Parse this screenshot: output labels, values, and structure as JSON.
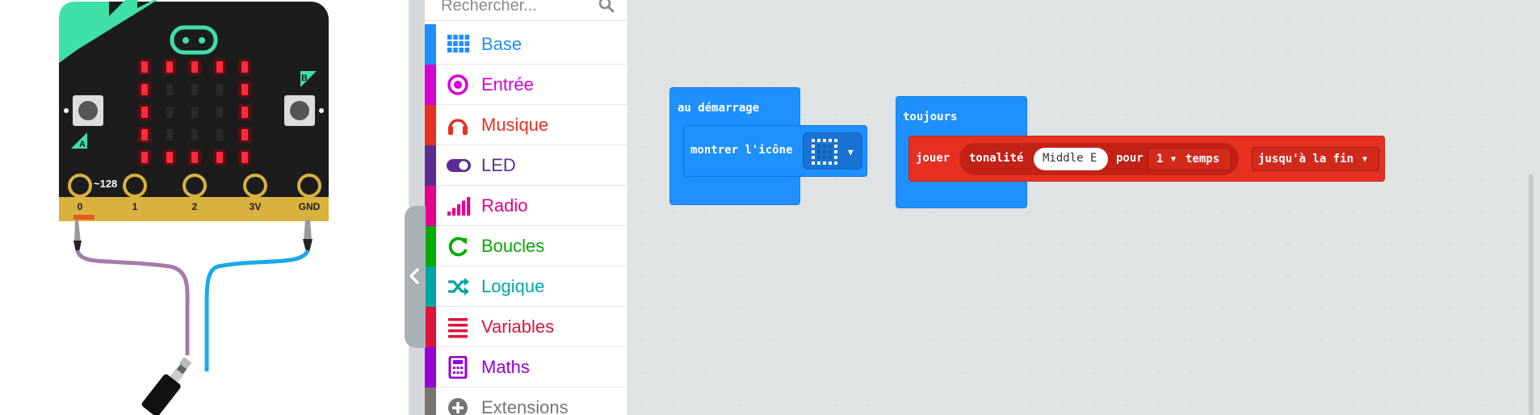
{
  "simulator": {
    "pin_labels": [
      "0",
      "1",
      "2",
      "3V",
      "GND"
    ],
    "analog_value": "~128",
    "button_a": "A",
    "button_b": "B"
  },
  "toolbox": {
    "search_placeholder": "Rechercher...",
    "categories": [
      {
        "label": "Base",
        "color": "#1e90ff",
        "icon": "grid-icon"
      },
      {
        "label": "Entrée",
        "color": "#d400d4",
        "icon": "circle-dot-icon"
      },
      {
        "label": "Musique",
        "color": "#e63022",
        "icon": "headphones-icon"
      },
      {
        "label": "LED",
        "color": "#5c2d91",
        "icon": "toggle-icon"
      },
      {
        "label": "Radio",
        "color": "#e3008c",
        "icon": "signal-bars-icon"
      },
      {
        "label": "Boucles",
        "color": "#00aa00",
        "icon": "loop-arrow-icon"
      },
      {
        "label": "Logique",
        "color": "#00a4a6",
        "icon": "shuffle-icon"
      },
      {
        "label": "Variables",
        "color": "#dc143c",
        "icon": "list-lines-icon"
      },
      {
        "label": "Maths",
        "color": "#9400d3",
        "icon": "calculator-icon"
      },
      {
        "label": "Extensions",
        "color": "#757575",
        "icon": "plus-circle-icon"
      }
    ]
  },
  "workspace": {
    "start_block": {
      "label": "au démarrage",
      "color": "#1e90ff"
    },
    "show_icon_block": {
      "label": "montrer l'icône"
    },
    "forever_block": {
      "label": "toujours"
    },
    "play_block": {
      "label": "jouer",
      "tone_label": "tonalité",
      "note": "Middle E",
      "for_label": "pour",
      "beats": "1",
      "beats_unit": "temps",
      "until": "jusqu'à la fin",
      "color": "#e63022"
    }
  }
}
